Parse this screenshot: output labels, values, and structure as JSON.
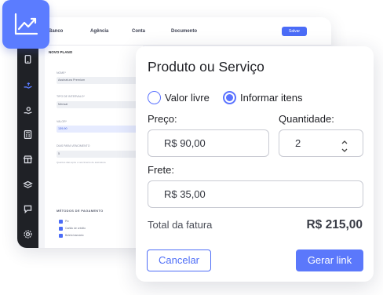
{
  "background_app": {
    "nav": [
      "Banco",
      "Agência",
      "Conta",
      "Documento"
    ],
    "top_button_label": "Salvar",
    "panel_title": "NOVO PLANO",
    "fields": [
      {
        "label": "NOME*",
        "value": "Assinatura Premium"
      },
      {
        "label": "TIPO DE INTERVALO*",
        "value": "Mensal"
      },
      {
        "label": "VALOR*",
        "value": "139,90"
      },
      {
        "label": "DIAS PARA VENCIMENTO",
        "value": "5"
      }
    ],
    "hint": "Quantos dias após o vencimento de assinatura",
    "payment_title": "MÉTODOS DE PAGAMENTO",
    "payment_methods": [
      "Pix",
      "Cartão de crédito",
      "Boleto bancário"
    ],
    "sidebar_icons": [
      "phone-icon",
      "hand-money-icon",
      "hand-coin-icon",
      "calculator-icon",
      "store-icon",
      "layers-icon",
      "chat-icon",
      "settings-icon"
    ]
  },
  "badge_icon": "chart-trend-icon",
  "modal": {
    "title": "Produto ou Serviço",
    "radio_options": [
      {
        "label": "Valor livre",
        "checked": false
      },
      {
        "label": "Informar itens",
        "checked": true
      }
    ],
    "price_label": "Preço:",
    "price_value": "R$ 90,00",
    "quantity_label": "Quantidade:",
    "quantity_value": "2",
    "freight_label": "Frete:",
    "freight_value": "R$ 35,00",
    "total_label": "Total da fatura",
    "total_value": "R$ 215,00",
    "cancel_label": "Cancelar",
    "submit_label": "Gerar link"
  },
  "colors": {
    "accent": "#5b78fb",
    "sidebar": "#1f2126"
  }
}
